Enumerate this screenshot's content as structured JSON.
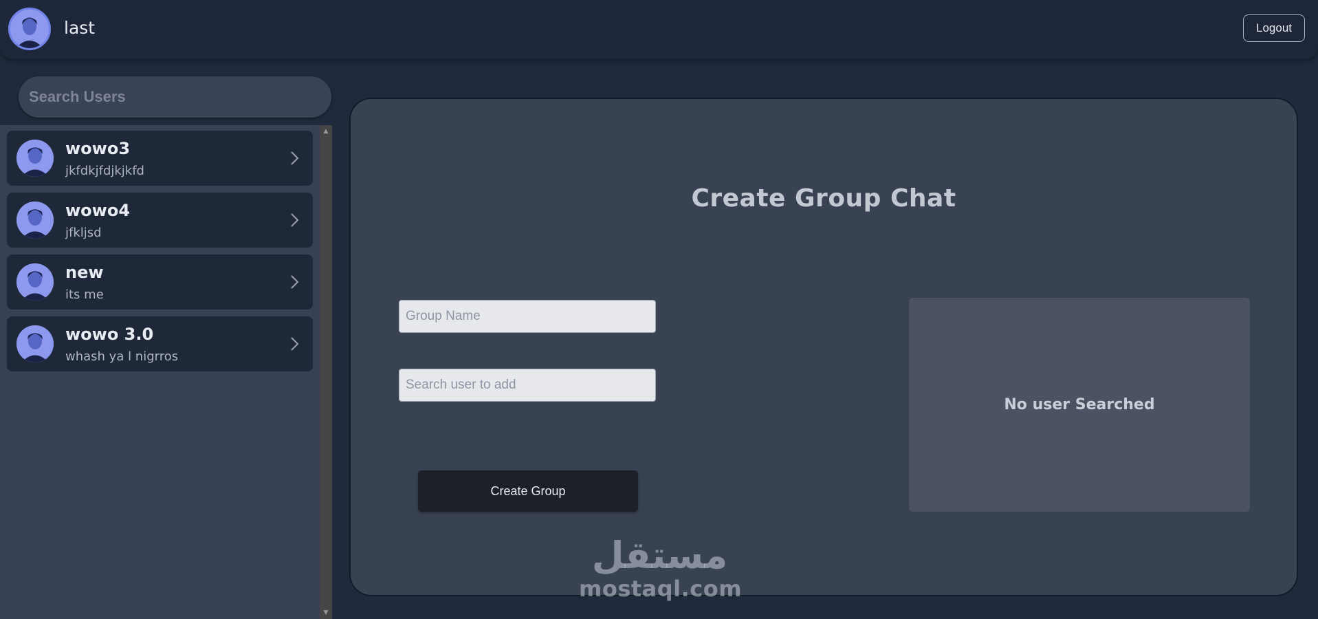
{
  "header": {
    "username": "last",
    "logout_label": "Logout"
  },
  "sidebar": {
    "search_placeholder": "Search Users",
    "users": [
      {
        "name": "wowo3",
        "status": "jkfdkjfdjkjkfd"
      },
      {
        "name": "wowo4",
        "status": "jfkljsd"
      },
      {
        "name": "new",
        "status": "its me"
      },
      {
        "name": "wowo 3.0",
        "status": "whash ya l nigrros"
      }
    ]
  },
  "main": {
    "title": "Create Group Chat",
    "group_name_placeholder": "Group Name",
    "search_user_placeholder": "Search user to add",
    "create_button_label": "Create Group",
    "empty_result_text": "No user Searched"
  },
  "watermark": {
    "arabic": "مستقل",
    "latin": "mostaql.com"
  },
  "colors": {
    "background": "#1f2a3c",
    "panel": "#394253",
    "accent": "#6f83e8"
  },
  "icons": {
    "chevron": "chevron-right-icon",
    "avatar": "avatar"
  }
}
